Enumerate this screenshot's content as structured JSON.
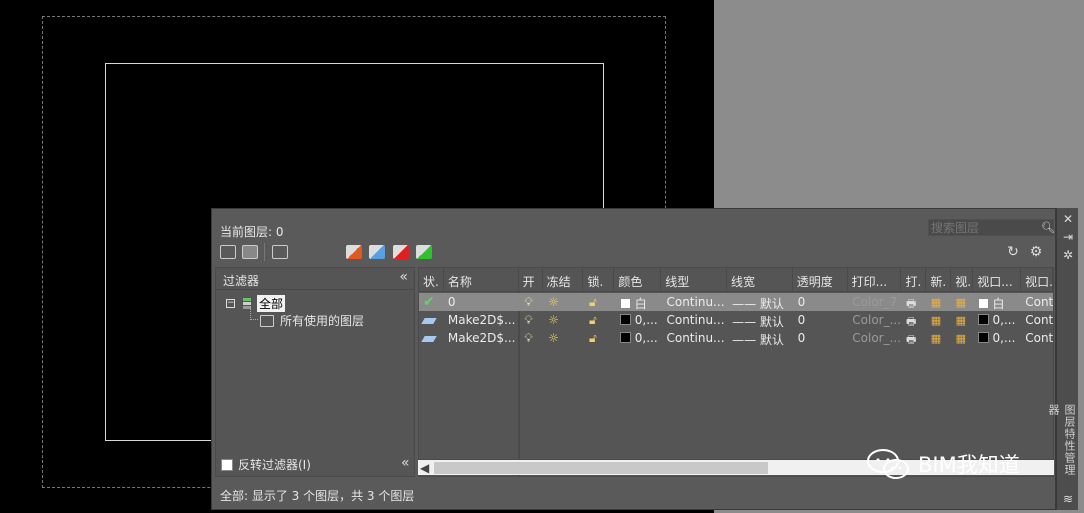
{
  "panel": {
    "current_layer": "当前图层: 0",
    "search_placeholder": "搜索图层",
    "vertical_title": "图层特性管理器"
  },
  "filter_pane": {
    "header": "过滤器",
    "root": "全部",
    "child": "所有使用的图层",
    "invert_label": "反转过滤器(I)"
  },
  "columns": [
    "状.",
    "名称",
    "开",
    "冻结",
    "锁.",
    "颜色",
    "线型",
    "线宽",
    "透明度",
    "打印...",
    "打.",
    "新.",
    "视.",
    "视口...",
    "视口."
  ],
  "layers": [
    {
      "name": "0",
      "color": "白",
      "color_hex": "#ffffff",
      "linetype": "Continu...",
      "lineweight": "—— 默认",
      "transparency": "0",
      "plot_style": "Color_7",
      "vp_color": "白",
      "vp_linetype": "Cont"
    },
    {
      "name": "Make2D$...",
      "color": "0,...",
      "color_hex": "#000000",
      "linetype": "Continu...",
      "lineweight": "—— 默认",
      "transparency": "0",
      "plot_style": "Color_...",
      "vp_color": "0,...",
      "vp_linetype": "Cont"
    },
    {
      "name": "Make2D$...",
      "color": "0,...",
      "color_hex": "#000000",
      "linetype": "Continu...",
      "lineweight": "—— 默认",
      "transparency": "0",
      "plot_style": "Color_...",
      "vp_color": "0,...",
      "vp_linetype": "Cont"
    }
  ],
  "status_text": "全部: 显示了 3 个图层，共 3 个图层",
  "watermark": "BIM我知道",
  "colors": {
    "canvas": "#000000",
    "panel": "#5a5a5a",
    "selected_row": "#8a8a8a",
    "background": "#8c8c8c"
  }
}
